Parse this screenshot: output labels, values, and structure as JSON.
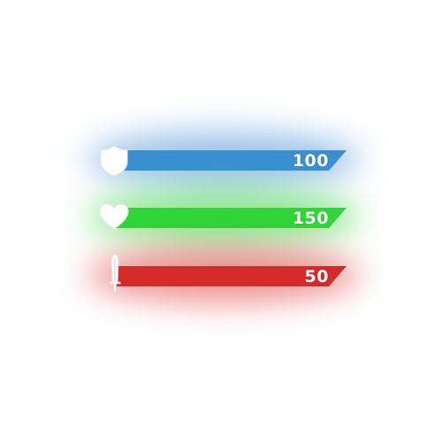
{
  "stats": [
    {
      "name": "armor",
      "icon": "shield-icon",
      "value": "100",
      "color": "#3a8fd0",
      "glow_color": "#4a8fd8"
    },
    {
      "name": "health",
      "icon": "heart-icon",
      "value": "150",
      "color": "#2ed637",
      "glow_color": "#35d63c"
    },
    {
      "name": "attack",
      "icon": "sword-icon",
      "value": "50",
      "color": "#d42a2a",
      "glow_color": "#e03535"
    }
  ]
}
